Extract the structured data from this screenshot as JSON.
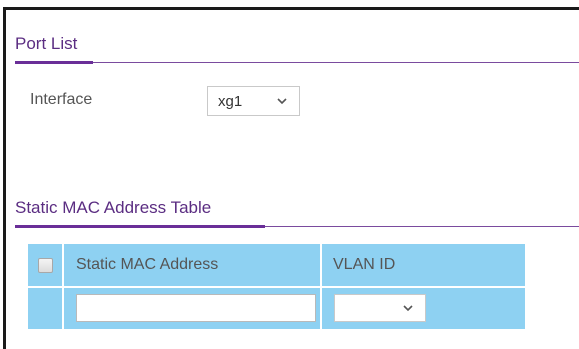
{
  "port_list": {
    "title": "Port List",
    "interface_label": "Interface",
    "interface_value": "xg1"
  },
  "static_mac_table": {
    "title": "Static MAC Address Table",
    "columns": [
      "Static MAC Address",
      "VLAN ID"
    ],
    "new_row": {
      "mac_address": "",
      "vlan_id": ""
    }
  },
  "colors": {
    "accent": "#6a2e98",
    "table_header_bg": "#8ed1f2"
  },
  "icons": {
    "dropdown": "chevron-down-icon"
  }
}
